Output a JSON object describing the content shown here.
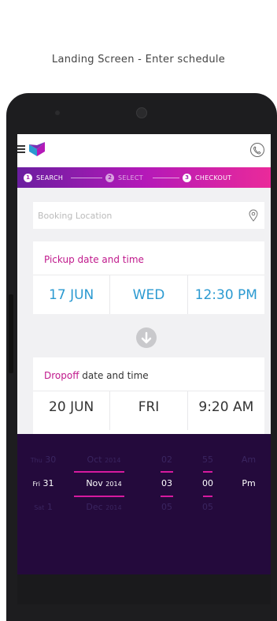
{
  "caption": "Landing Screen - Enter schedule",
  "steps": [
    {
      "num": "1",
      "label": "SEARCH"
    },
    {
      "num": "2",
      "label": "SELECT"
    },
    {
      "num": "3",
      "label": "CHECKOUT"
    }
  ],
  "location": {
    "placeholder": "Booking Location"
  },
  "pickup": {
    "title": "Pickup date and time",
    "date": "17 JUN",
    "day": "WED",
    "time": "12:30 PM"
  },
  "dropoff": {
    "title_accent": "Dropoff",
    "title_rest": " date and time",
    "date": "20 JUN",
    "day": "FRI",
    "time": "9:20 AM"
  },
  "picker": {
    "day_prev": {
      "prefix": "Thu",
      "num": "30"
    },
    "day_sel": {
      "prefix": "Fri",
      "num": "31"
    },
    "day_next": {
      "prefix": "Sat",
      "num": "1"
    },
    "month_prev": {
      "month": "Oct",
      "year": "2014"
    },
    "month_sel": {
      "month": "Nov",
      "year": "2014"
    },
    "month_next": {
      "month": "Dec",
      "year": "2014"
    },
    "hour_prev": "02",
    "hour_sel": "03",
    "hour_next": "05",
    "min_prev": "55",
    "min_sel": "00",
    "min_next": "05",
    "ampm_prev": "Am",
    "ampm_sel": "Pm"
  },
  "colors": {
    "accent_pink": "#c0198c",
    "time_blue": "#2b9ad1",
    "picker_bg": "#240a3c",
    "gradient_start": "#6b1ea0",
    "gradient_end": "#ea2a9a"
  }
}
